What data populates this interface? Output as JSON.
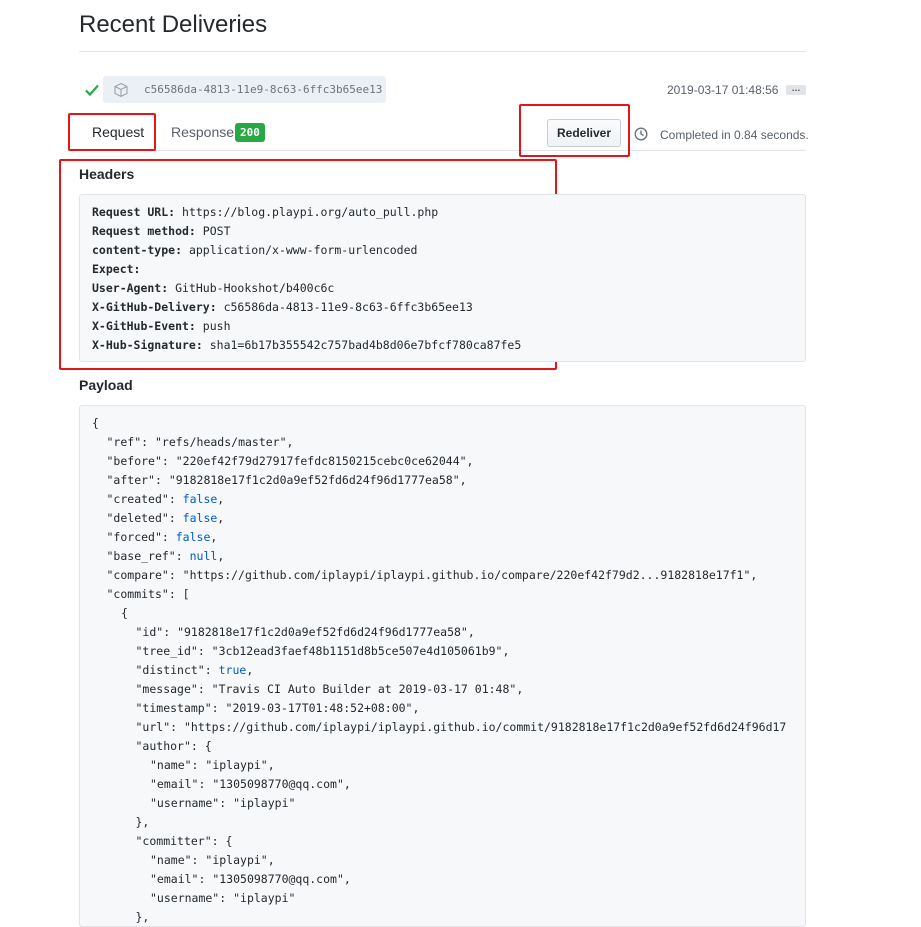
{
  "page": {
    "title": "Recent Deliveries"
  },
  "delivery": {
    "guid": "c56586da-4813-11e9-8c63-6ffc3b65ee13",
    "timestamp": "2019-03-17 01:48:56",
    "ellipsis": "…"
  },
  "tabs": {
    "request": "Request",
    "response": "Response",
    "response_badge": "200"
  },
  "actions": {
    "redeliver": "Redeliver",
    "completed": "Completed in 0.84 seconds."
  },
  "headers": {
    "title": "Headers",
    "items": [
      {
        "key": "Request URL:",
        "value": "https://blog.playpi.org/auto_pull.php"
      },
      {
        "key": "Request method:",
        "value": "POST"
      },
      {
        "key": "content-type:",
        "value": "application/x-www-form-urlencoded"
      },
      {
        "key": "Expect:",
        "value": ""
      },
      {
        "key": "User-Agent:",
        "value": "GitHub-Hookshot/b400c6c"
      },
      {
        "key": "X-GitHub-Delivery:",
        "value": "c56586da-4813-11e9-8c63-6ffc3b65ee13"
      },
      {
        "key": "X-GitHub-Event:",
        "value": "push"
      },
      {
        "key": "X-Hub-Signature:",
        "value": "sha1=6b17b355542c757bad4b8d06e7bfcf780ca87fe5"
      }
    ]
  },
  "payload": {
    "title": "Payload",
    "lines": [
      {
        "indent": 0,
        "text": "{"
      },
      {
        "indent": 1,
        "key": "\"ref\"",
        "val": "\"refs/heads/master\"",
        "type": "str",
        "tail": ","
      },
      {
        "indent": 1,
        "key": "\"before\"",
        "val": "\"220ef42f79d27917fefdc8150215cebc0ce62044\"",
        "type": "str",
        "tail": ","
      },
      {
        "indent": 1,
        "key": "\"after\"",
        "val": "\"9182818e17f1c2d0a9ef52fd6d24f96d1777ea58\"",
        "type": "str",
        "tail": ","
      },
      {
        "indent": 1,
        "key": "\"created\"",
        "val": "false",
        "type": "lit",
        "tail": ","
      },
      {
        "indent": 1,
        "key": "\"deleted\"",
        "val": "false",
        "type": "lit",
        "tail": ","
      },
      {
        "indent": 1,
        "key": "\"forced\"",
        "val": "false",
        "type": "lit",
        "tail": ","
      },
      {
        "indent": 1,
        "key": "\"base_ref\"",
        "val": "null",
        "type": "lit",
        "tail": ","
      },
      {
        "indent": 1,
        "key": "\"compare\"",
        "val": "\"https://github.com/iplaypi/iplaypi.github.io/compare/220ef42f79d2...9182818e17f1\"",
        "type": "str",
        "tail": ","
      },
      {
        "indent": 1,
        "key": "\"commits\"",
        "val": "[",
        "type": "punc",
        "tail": ""
      },
      {
        "indent": 2,
        "text": "{"
      },
      {
        "indent": 3,
        "key": "\"id\"",
        "val": "\"9182818e17f1c2d0a9ef52fd6d24f96d1777ea58\"",
        "type": "str",
        "tail": ","
      },
      {
        "indent": 3,
        "key": "\"tree_id\"",
        "val": "\"3cb12ead3faef48b1151d8b5ce507e4d105061b9\"",
        "type": "str",
        "tail": ","
      },
      {
        "indent": 3,
        "key": "\"distinct\"",
        "val": "true",
        "type": "lit",
        "tail": ","
      },
      {
        "indent": 3,
        "key": "\"message\"",
        "val": "\"Travis CI Auto Builder at 2019-03-17 01:48\"",
        "type": "str",
        "tail": ","
      },
      {
        "indent": 3,
        "key": "\"timestamp\"",
        "val": "\"2019-03-17T01:48:52+08:00\"",
        "type": "str",
        "tail": ","
      },
      {
        "indent": 3,
        "key": "\"url\"",
        "val": "\"https://github.com/iplaypi/iplaypi.github.io/commit/9182818e17f1c2d0a9ef52fd6d24f96d17",
        "type": "str",
        "tail": ""
      },
      {
        "indent": 3,
        "key": "\"author\"",
        "val": "{",
        "type": "punc",
        "tail": ""
      },
      {
        "indent": 4,
        "key": "\"name\"",
        "val": "\"iplaypi\"",
        "type": "str",
        "tail": ","
      },
      {
        "indent": 4,
        "key": "\"email\"",
        "val": "\"1305098770@qq.com\"",
        "type": "str",
        "tail": ","
      },
      {
        "indent": 4,
        "key": "\"username\"",
        "val": "\"iplaypi\"",
        "type": "str",
        "tail": ""
      },
      {
        "indent": 3,
        "text": "},"
      },
      {
        "indent": 3,
        "key": "\"committer\"",
        "val": "{",
        "type": "punc",
        "tail": ""
      },
      {
        "indent": 4,
        "key": "\"name\"",
        "val": "\"iplaypi\"",
        "type": "str",
        "tail": ","
      },
      {
        "indent": 4,
        "key": "\"email\"",
        "val": "\"1305098770@qq.com\"",
        "type": "str",
        "tail": ","
      },
      {
        "indent": 4,
        "key": "\"username\"",
        "val": "\"iplaypi\"",
        "type": "str",
        "tail": ""
      },
      {
        "indent": 3,
        "text": "},"
      }
    ]
  },
  "colors": {
    "success": "#28a745",
    "highlight": "#e5141a",
    "literal": "#005cc5"
  },
  "icons": {
    "status": "check-icon",
    "guid": "cube-icon",
    "duration": "clock-icon"
  }
}
